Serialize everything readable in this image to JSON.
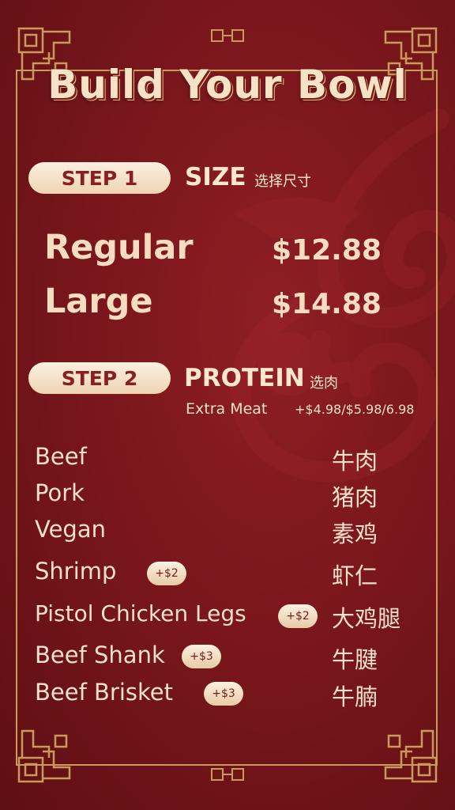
{
  "title": "Build Your Bowl",
  "step1": {
    "pill": "STEP 1",
    "title": "SIZE",
    "title_cn": "选择尺寸"
  },
  "sizes": [
    {
      "name": "Regular",
      "price": "$12.88"
    },
    {
      "name": "Large",
      "price": "$14.88"
    }
  ],
  "step2": {
    "pill": "STEP 2",
    "title": "PROTEIN",
    "title_cn": "选肉",
    "extra_label": "Extra Meat",
    "extra_value": "+$4.98/$5.98/6.98"
  },
  "proteins": [
    {
      "name": "Beef",
      "cn": "牛肉",
      "badge": ""
    },
    {
      "name": "Pork",
      "cn": "猪肉",
      "badge": ""
    },
    {
      "name": "Vegan",
      "cn": "素鸡",
      "badge": ""
    },
    {
      "name": "Shrimp",
      "cn": "虾仁",
      "badge": "+$2"
    },
    {
      "name": "Pistol Chicken Legs",
      "cn": "大鸡腿",
      "badge": "+$2"
    },
    {
      "name": "Beef Shank",
      "cn": "牛腱",
      "badge": "+$3"
    },
    {
      "name": "Beef Brisket",
      "cn": "牛腩",
      "badge": "+$3"
    }
  ],
  "colors": {
    "background": "#7a171c",
    "gold": "#c99a5b",
    "cream": "#f6e2c6",
    "pill_text": "#8a1f22"
  },
  "icons": {
    "corner": "chinese-knot-corner-icon",
    "background": "dragon-silhouette-icon"
  }
}
